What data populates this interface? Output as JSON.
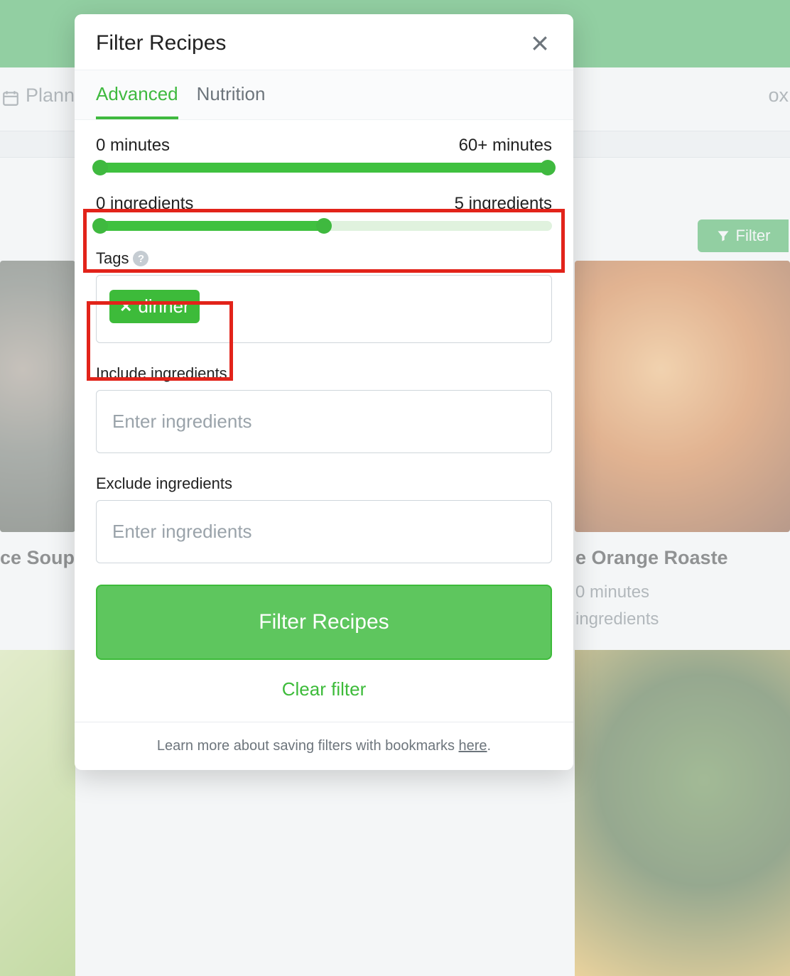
{
  "background": {
    "nav_label": "Planne",
    "nav_right_fragment": "ox",
    "filter_button": "Filter",
    "left_card_title_fragment": "ce Soup",
    "right_card_title_fragment": "e Orange Roaste",
    "right_card_minutes": "0 minutes",
    "right_card_ingredients": "ingredients"
  },
  "modal": {
    "title": "Filter Recipes",
    "tabs": [
      {
        "label": "Advanced",
        "active": true
      },
      {
        "label": "Nutrition",
        "active": false
      }
    ],
    "time_slider": {
      "min_label": "0 minutes",
      "max_label": "60+ minutes",
      "fill_percent": 100
    },
    "ingredients_slider": {
      "min_label": "0 ingredients",
      "max_label": "5 ingredients",
      "fill_percent": 50
    },
    "tags_label": "Tags",
    "tags": [
      {
        "text": "dinner"
      }
    ],
    "include_label": "Include ingredients",
    "include_placeholder": "Enter ingredients",
    "exclude_label": "Exclude ingredients",
    "exclude_placeholder": "Enter ingredients",
    "submit_label": "Filter Recipes",
    "clear_label": "Clear filter",
    "footer_text": "Learn more about saving filters with bookmarks ",
    "footer_link": "here"
  }
}
